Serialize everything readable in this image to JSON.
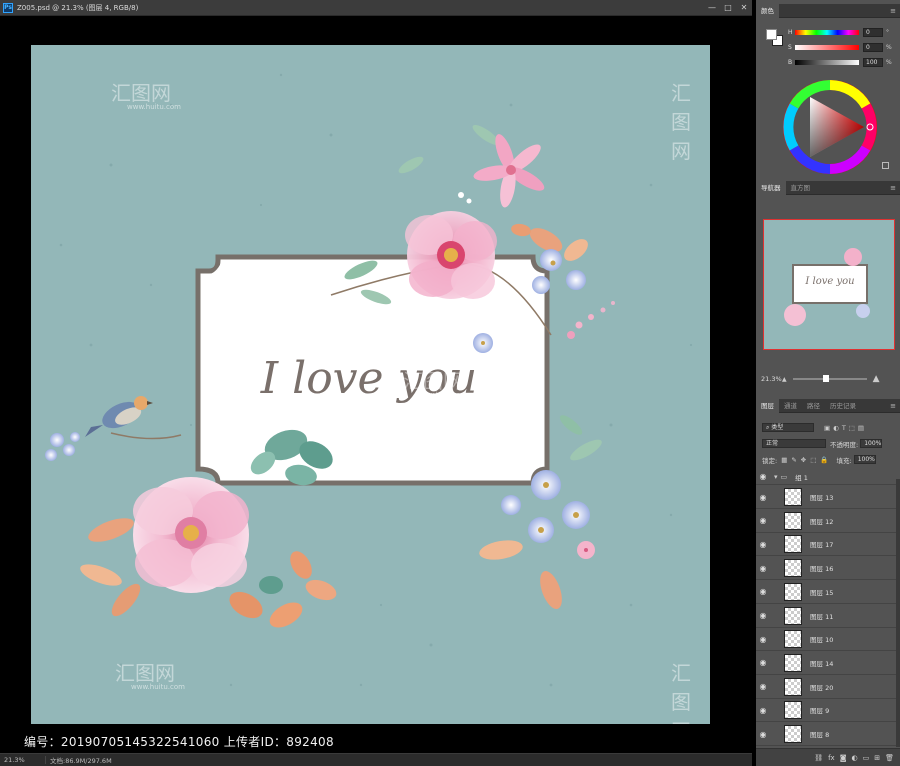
{
  "document": {
    "title": "Z005.psd @ 21.3% (图层 4, RGB/8)",
    "window_buttons": [
      "—",
      "□",
      "✕"
    ],
    "artwork_text": "I love you",
    "watermark_url": "www.huitu.com",
    "credit_text": "编号：20190705145322541060 上传者ID：892408",
    "status_zoom": "21.3%",
    "status_info": "文档:86.9M/297.6M",
    "colors": {
      "background": "#93b7b8",
      "frame": "#77706a",
      "text": "#7a706b"
    }
  },
  "color_panel": {
    "tab": "颜色",
    "sliders": [
      {
        "label": "H",
        "value": "0",
        "unit": "°"
      },
      {
        "label": "S",
        "value": "0",
        "unit": "%"
      },
      {
        "label": "B",
        "value": "100",
        "unit": "%"
      }
    ]
  },
  "navigator": {
    "tabs": [
      "导航器",
      "直方图"
    ],
    "zoom": "21.3%",
    "thumb_text": "I love you"
  },
  "layers": {
    "tabs": [
      "图层",
      "通道",
      "路径",
      "历史记录"
    ],
    "filter_label": "类型",
    "blend_mode": "正常",
    "opacity_label": "不透明度:",
    "opacity": "100%",
    "lock_label": "锁定:",
    "fill_label": "填充:",
    "fill": "100%",
    "group": "组 1",
    "items": [
      "图层 13",
      "图层 12",
      "图层 17",
      "图层 16",
      "图层 15",
      "图层 11",
      "图层 10",
      "图层 14",
      "图层 20",
      "图层 9",
      "图层 8"
    ]
  }
}
